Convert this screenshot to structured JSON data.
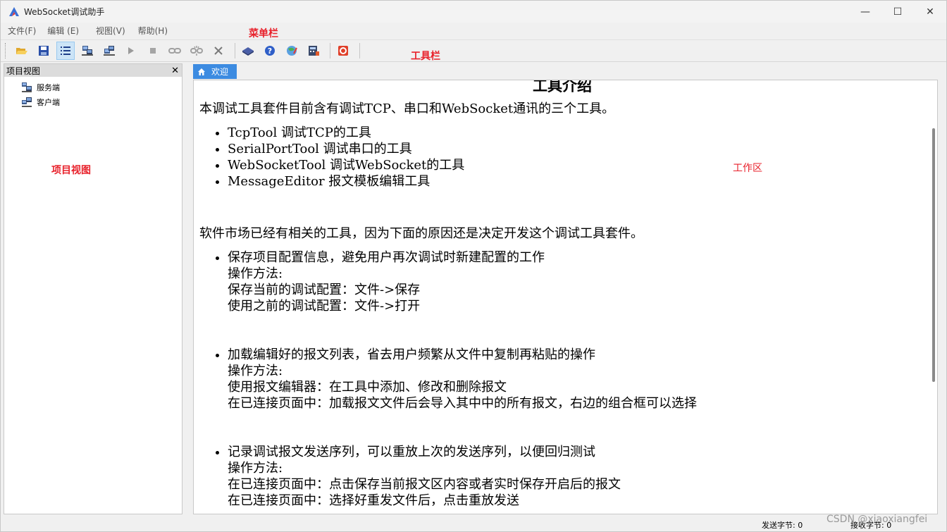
{
  "window": {
    "title": "WebSocket调试助手",
    "buttons": {
      "minimize": "—",
      "maximize": "☐",
      "close": "✕"
    }
  },
  "menu": {
    "items": [
      "文件(F)",
      "编辑 (E)",
      "视图(V)",
      "帮助(H)"
    ]
  },
  "annotations": {
    "menubar": "菜单栏",
    "toolbar": "工具栏",
    "project_view": "项目视图",
    "work_area": "工作区"
  },
  "toolbar": {
    "icons": [
      "open-folder-icon",
      "save-icon",
      "list-icon",
      "server-icon",
      "client-icon",
      "play-icon",
      "stop-icon",
      "link-icon",
      "unlink-icon",
      "delete-icon",
      "book-icon",
      "help-icon",
      "globe-icon",
      "calculator-icon",
      "record-icon"
    ]
  },
  "project_panel": {
    "title": "项目视图",
    "close": "✕",
    "items": [
      "服务端",
      "客户端"
    ]
  },
  "tab": {
    "label": "欢迎"
  },
  "content": {
    "heading": "工具介绍",
    "intro": "本调试工具套件目前含有调试TCP、串口和WebSocket通讯的三个工具。",
    "tools": [
      "TcpTool 调试TCP的工具",
      "SerialPortTool 调试串口的工具",
      "WebSocketTool 调试WebSocket的工具",
      "MessageEditor 报文模板编辑工具"
    ],
    "reason": "软件市场已经有相关的工具，因为下面的原因还是决定开发这个调试工具套件。",
    "features": [
      {
        "title": "保存项目配置信息，避免用户再次调试时新建配置的工作",
        "lines": [
          "操作方法:",
          "保存当前的调试配置：文件->保存",
          "使用之前的调试配置：文件->打开"
        ]
      },
      {
        "title": "加载编辑好的报文列表，省去用户频繁从文件中复制再粘贴的操作",
        "lines": [
          "操作方法:",
          "使用报文编辑器：在工具中添加、修改和删除报文",
          "在已连接页面中：加载报文文件后会导入其中中的所有报文，右边的组合框可以选择"
        ]
      },
      {
        "title": "记录调试报文发送序列，可以重放上次的发送序列，以便回归测试",
        "lines": [
          "操作方法:",
          "在已连接页面中：点击保存当前报文区内容或者实时保存开启后的报文",
          "在已连接页面中：选择好重发文件后，点击重放发送"
        ]
      }
    ]
  },
  "status": {
    "send": "发送字节: 0",
    "recv": "接收字节: 0"
  },
  "watermark": "CSDN @xiaoxiangfei",
  "colors": {
    "tab": "#3c8be1",
    "annotation": "#e8212b"
  }
}
